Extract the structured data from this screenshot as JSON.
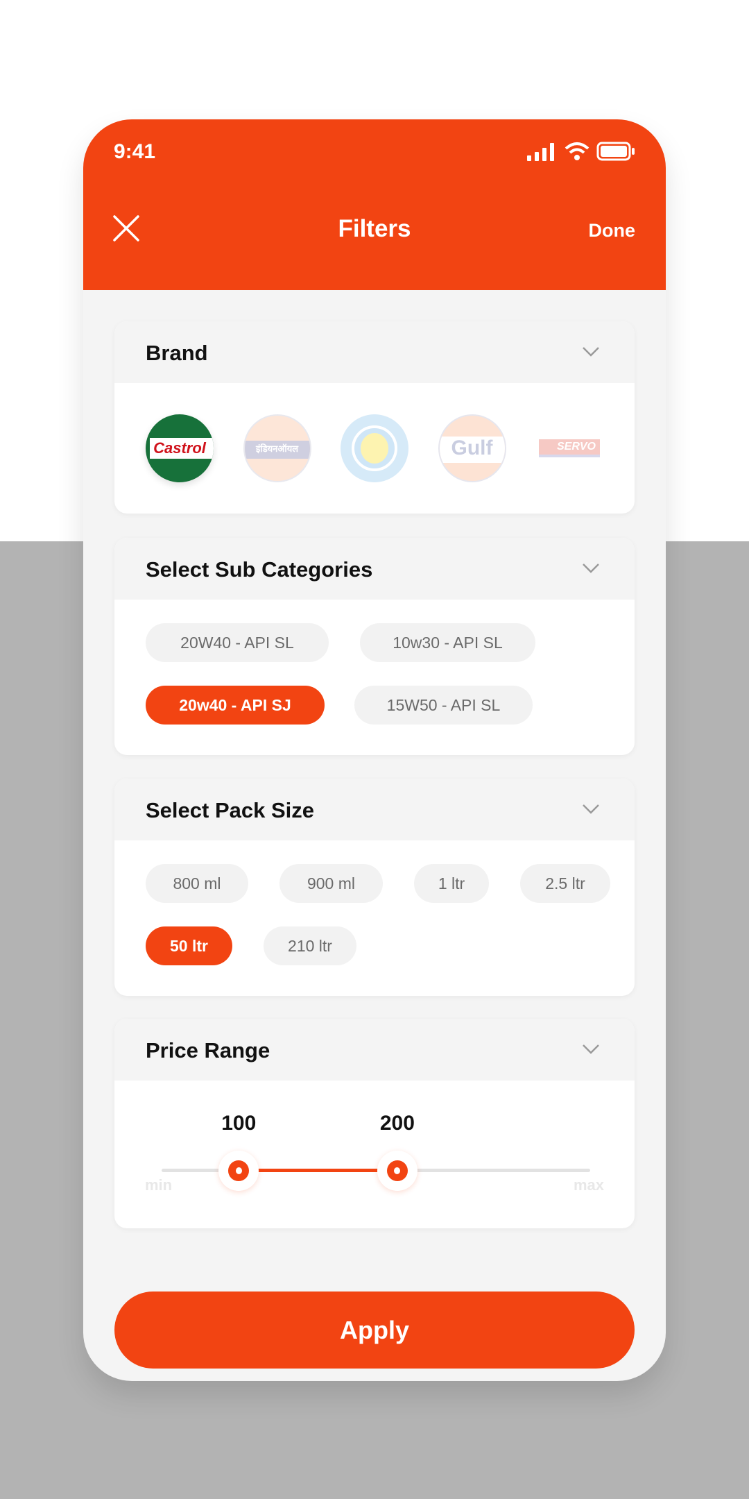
{
  "status_bar": {
    "time": "9:41"
  },
  "header": {
    "title": "Filters",
    "done_label": "Done",
    "close_icon": "close-icon"
  },
  "brand": {
    "title": "Brand",
    "logos": [
      {
        "name": "Castrol",
        "text": "Castrol",
        "selected": true
      },
      {
        "name": "Indian Oil",
        "text": "इंडियनऑयल",
        "selected": false
      },
      {
        "name": "Bharat Petroleum",
        "text": "",
        "selected": false
      },
      {
        "name": "Gulf",
        "text": "Gulf",
        "selected": false
      },
      {
        "name": "Servo",
        "text": "SERVO",
        "selected": false
      }
    ]
  },
  "sub_categories": {
    "title": "Select Sub Categories",
    "options": [
      {
        "label": "20W40 - API SL",
        "selected": false
      },
      {
        "label": "10w30 - API SL",
        "selected": false
      },
      {
        "label": "20w40 - API SJ",
        "selected": true
      },
      {
        "label": "15W50 - API SL",
        "selected": false
      }
    ]
  },
  "pack_size": {
    "title": "Select Pack Size",
    "options": [
      {
        "label": "800 ml",
        "selected": false
      },
      {
        "label": "900 ml",
        "selected": false
      },
      {
        "label": "1 ltr",
        "selected": false
      },
      {
        "label": "2.5 ltr",
        "selected": false
      },
      {
        "label": "50 ltr",
        "selected": true
      },
      {
        "label": "210 ltr",
        "selected": false
      }
    ]
  },
  "price_range": {
    "title": "Price Range",
    "low_value": "100",
    "high_value": "200",
    "low_fraction": 0.18,
    "high_fraction": 0.55,
    "min_label": "min",
    "max_label": "max"
  },
  "apply_label": "Apply",
  "colors": {
    "accent": "#f24412",
    "card_header": "#f4f4f4",
    "chip": "#f2f2f2"
  }
}
